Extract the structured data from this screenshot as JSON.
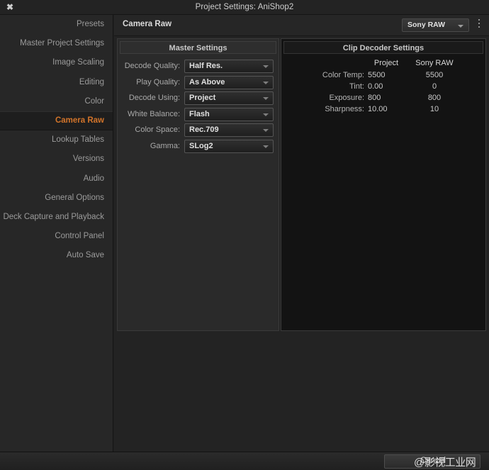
{
  "window": {
    "title": "Project Settings:  AniShop2",
    "close_icon": "close-icon"
  },
  "sidebar": {
    "items": [
      {
        "label": "Presets",
        "selected": false
      },
      {
        "label": "Master Project Settings",
        "selected": false
      },
      {
        "label": "Image Scaling",
        "selected": false
      },
      {
        "label": "Editing",
        "selected": false
      },
      {
        "label": "Color",
        "selected": false
      },
      {
        "label": "Camera Raw",
        "selected": true
      },
      {
        "label": "Lookup Tables",
        "selected": false
      },
      {
        "label": "Versions",
        "selected": false
      },
      {
        "label": "Audio",
        "selected": false
      },
      {
        "label": "General Options",
        "selected": false
      },
      {
        "label": "Deck Capture and Playback",
        "selected": false
      },
      {
        "label": "Control Panel",
        "selected": false
      },
      {
        "label": "Auto Save",
        "selected": false
      }
    ]
  },
  "content": {
    "title": "Camera Raw",
    "source_select": {
      "value": "Sony RAW",
      "caret_icon": "chevron-down-icon"
    },
    "kebab_icon": "more-options-icon"
  },
  "master_settings": {
    "title": "Master Settings",
    "fields": [
      {
        "label": "Decode Quality:",
        "value": "Half Res."
      },
      {
        "label": "Play Quality:",
        "value": "As Above"
      },
      {
        "label": "Decode Using:",
        "value": "Project"
      },
      {
        "label": "White Balance:",
        "value": "Flash"
      },
      {
        "label": "Color Space:",
        "value": "Rec.709"
      },
      {
        "label": "Gamma:",
        "value": "SLog2"
      }
    ]
  },
  "clip_decoder": {
    "title": "Clip Decoder Settings",
    "columns": {
      "label": "",
      "project": "Project",
      "source": "Sony RAW"
    },
    "rows": [
      {
        "label": "Color Temp:",
        "project": "5500",
        "source": "5500"
      },
      {
        "label": "Tint:",
        "project": "0.00",
        "source": "0"
      },
      {
        "label": "Exposure:",
        "project": "800",
        "source": "800"
      },
      {
        "label": "Sharpness:",
        "project": "10.00",
        "source": "10"
      }
    ]
  },
  "footer": {
    "cancel_label": "Cancel",
    "watermark": "@影视工业网"
  },
  "colors": {
    "accent": "#d2742a",
    "window_bg": "#222222",
    "sidebar_bg": "#272727",
    "panel_master_bg": "#2a2a2a",
    "panel_clip_bg": "#131313",
    "text": "#b8b8b8"
  }
}
